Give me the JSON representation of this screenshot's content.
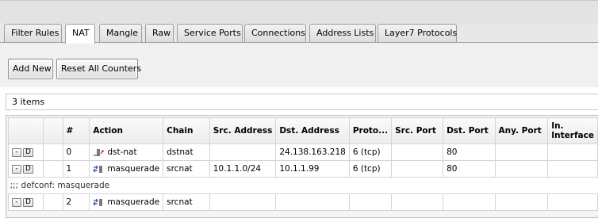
{
  "tabs": [
    "Filter Rules",
    "NAT",
    "Mangle",
    "Raw",
    "Service Ports",
    "Connections",
    "Address Lists",
    "Layer7 Protocols"
  ],
  "active_tab": "NAT",
  "toolbar": {
    "add_new": "Add New",
    "reset_counters": "Reset All Counters"
  },
  "item_count": "3 items",
  "columns": [
    "#",
    "Action",
    "Chain",
    "Src. Address",
    "Dst. Address",
    "Proto...",
    "Src. Port",
    "Dst. Port",
    "Any. Port",
    "In. Interface"
  ],
  "row_buttons": {
    "remove": "-",
    "disable": "D"
  },
  "comment": ";;; defconf: masquerade",
  "rows": [
    {
      "num": "0",
      "action": "dst-nat",
      "action_icon": "dst-nat-icon",
      "chain": "dstnat",
      "src_address": "",
      "dst_address": "24.138.163.218",
      "protocol": "6 (tcp)",
      "src_port": "",
      "dst_port": "80",
      "any_port": "",
      "in_interface": ""
    },
    {
      "num": "1",
      "action": "masquerade",
      "action_icon": "masquerade-icon",
      "chain": "srcnat",
      "src_address": "10.1.1.0/24",
      "dst_address": "10.1.1.99",
      "protocol": "6 (tcp)",
      "src_port": "",
      "dst_port": "80",
      "any_port": "",
      "in_interface": ""
    },
    {
      "num": "2",
      "action": "masquerade",
      "action_icon": "masquerade-icon",
      "chain": "srcnat",
      "src_address": "",
      "dst_address": "",
      "protocol": "",
      "src_port": "",
      "dst_port": "",
      "any_port": "",
      "in_interface": ""
    }
  ]
}
